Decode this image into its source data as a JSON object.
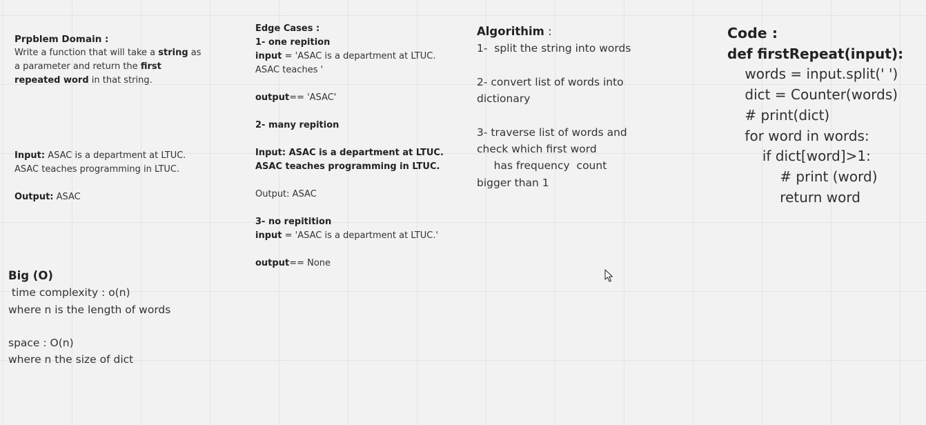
{
  "problem": {
    "title": "Prpblem Domain :",
    "line1_a": "Write a function that will take a ",
    "line1_b": "string",
    "line1_c": " as",
    "line2_a": "a parameter and return the ",
    "line2_b": "first",
    "line3_a": "repeated word",
    "line3_b": " in that string."
  },
  "io": {
    "input_label": "Input:",
    "input_text": " ASAC is a department at LTUC.",
    "input_text2": "ASAC teaches programming in LTUC.",
    "output_label": "Output:",
    "output_text": " ASAC"
  },
  "edge": {
    "title": "Edge Cases :",
    "case1_title": "1- one repition",
    "case1_input_label": "input",
    "case1_input_text": " = 'ASAC is a department at LTUC.",
    "case1_input_text2": "ASAC teaches '",
    "case1_output_label": "output",
    "case1_output_text": "== 'ASAC'",
    "case2_title": "2- many repition",
    "case2_input_line1": "Input: ASAC is a department at LTUC.",
    "case2_input_line2": "ASAC teaches programming in LTUC.",
    "case2_output": "Output: ASAC",
    "case3_title": "3- no repitition",
    "case3_input_label": "input",
    "case3_input_text": " = 'ASAC is a department at LTUC.'",
    "case3_output_label": "output",
    "case3_output_text": "== None"
  },
  "algo": {
    "title": "Algorithim",
    "title_suffix": " :",
    "step1": "1-  split the string into words",
    "step2_line1": "2- convert list of words into",
    "step2_line2": "dictionary",
    "step3_line1": "3- traverse list of words and",
    "step3_line2": "check which first word",
    "step3_line3": "     has frequency  count",
    "step3_line4": "bigger than 1"
  },
  "code": {
    "title": "Code :",
    "lines": [
      "def firstRepeat(input):",
      "    words = input.split(' ')",
      "    dict = Counter(words)",
      "    # print(dict)",
      "    for word in words:",
      "        if dict[word]>1:",
      "            # print (word)",
      "            return word"
    ]
  },
  "bigo": {
    "title": "Big (O)",
    "time": " time complexity : o(n)",
    "time_note": "where n is the length of words",
    "space": "space : O(n)",
    "space_note": "where n the size of dict"
  },
  "icons": {
    "cursor": "mouse-pointer-icon"
  }
}
